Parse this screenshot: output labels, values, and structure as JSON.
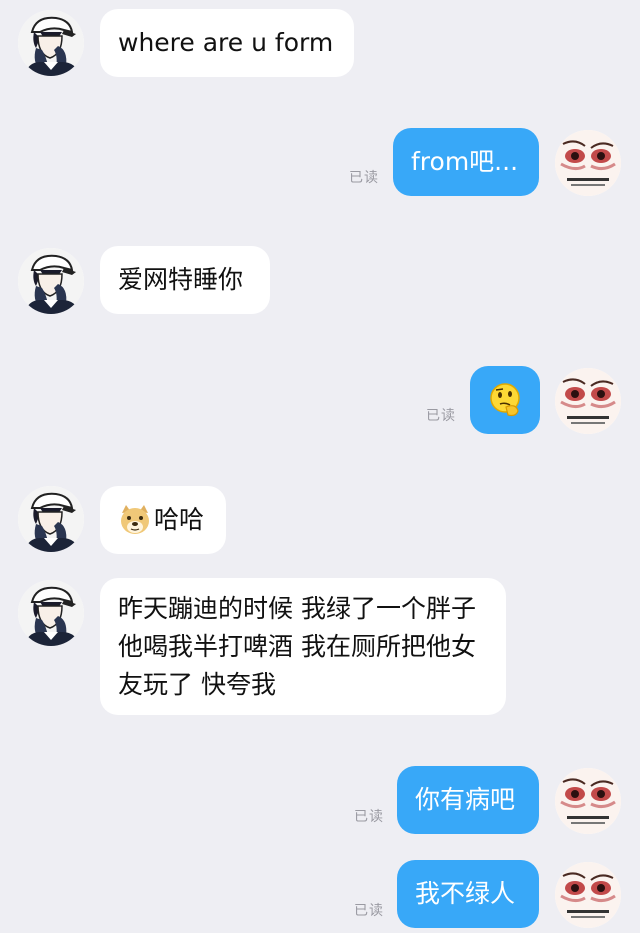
{
  "messages": [
    {
      "side": "in",
      "text": "where are u form"
    },
    {
      "side": "out",
      "text": "from吧...",
      "status": "已读"
    },
    {
      "side": "in",
      "text": "爱网特睡你"
    },
    {
      "side": "out",
      "emoji": "thinking-face-emoji",
      "status": "已读"
    },
    {
      "side": "in",
      "emoji": "doge-emoji",
      "text": "哈哈"
    },
    {
      "side": "in",
      "text": "昨天蹦迪的时候 我绿了一个胖子 他喝我半打啤酒 我在厕所把他女友玩了 快夸我"
    },
    {
      "side": "out",
      "text": "你有病吧",
      "status": "已读"
    },
    {
      "side": "out",
      "text": "我不绿人",
      "status": "已读"
    }
  ],
  "colors": {
    "background": "#eeeef3",
    "incoming_bubble": "#ffffff",
    "outgoing_bubble": "#38a8f8",
    "read_status": "#9a9aa2"
  }
}
